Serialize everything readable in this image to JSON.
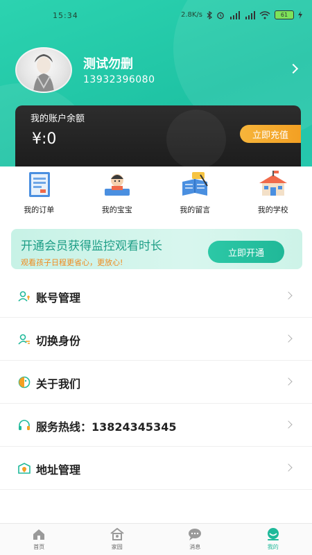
{
  "status_bar": {
    "time": "15:34",
    "speed": "2.8K/s",
    "battery": "61",
    "icons": [
      "bluetooth-icon",
      "alarm-icon",
      "signal-hd-icon",
      "signal-hd-icon",
      "wifi-icon",
      "battery-icon",
      "charging-icon"
    ]
  },
  "profile": {
    "name": "测试勿删",
    "phone": "13932396080"
  },
  "balance": {
    "label": "我的账户余额",
    "value": "¥:0",
    "recharge_label": "立即充值"
  },
  "quick_actions": [
    {
      "label": "我的订单",
      "icon": "order-icon"
    },
    {
      "label": "我的宝宝",
      "icon": "baby-icon"
    },
    {
      "label": "我的留言",
      "icon": "message-icon"
    },
    {
      "label": "我的学校",
      "icon": "school-icon"
    }
  ],
  "vip": {
    "title": "开通会员获得监控观看时长",
    "subtitle": "观看孩子日程更省心，更放心!",
    "button": "立即开通"
  },
  "menu": [
    {
      "label": "账号管理",
      "icon": "account-icon"
    },
    {
      "label": "切换身份",
      "icon": "switch-identity-icon"
    },
    {
      "label": "关于我们",
      "icon": "about-icon"
    },
    {
      "label": "服务热线：13824345345",
      "icon": "headset-icon"
    },
    {
      "label": "地址管理",
      "icon": "address-icon"
    }
  ],
  "tabs": [
    {
      "label": "首页",
      "icon": "home-icon",
      "active": false
    },
    {
      "label": "家园",
      "icon": "family-icon",
      "active": false
    },
    {
      "label": "消息",
      "icon": "chat-icon",
      "active": false
    },
    {
      "label": "我的",
      "icon": "profile-icon",
      "active": true
    }
  ],
  "colors": {
    "brand": "#1fc3a4",
    "accent_orange": "#f3a023",
    "card_dark": "#1c1c1c"
  }
}
